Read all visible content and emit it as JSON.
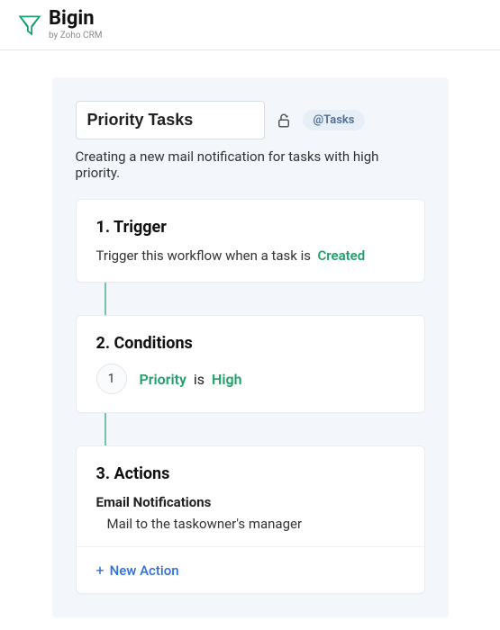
{
  "brand": {
    "name": "Bigin",
    "tagline": "by Zoho CRM"
  },
  "workflow": {
    "title": "Priority Tasks",
    "tag": "@Tasks",
    "description": "Creating a new mail notification for tasks with high priority."
  },
  "trigger": {
    "heading": "1. Trigger",
    "prefix": "Trigger this workflow when a task is",
    "event": "Created"
  },
  "conditions": {
    "heading": "2. Conditions",
    "items": [
      {
        "index": "1",
        "field": "Priority",
        "op": "is",
        "value": "High"
      }
    ]
  },
  "actions": {
    "heading": "3. Actions",
    "section_label": "Email Notifications",
    "items": [
      "Mail to the taskowner's manager"
    ],
    "new_action_label": "New Action"
  },
  "colors": {
    "accent": "#22a06b",
    "link": "#2f6fd8"
  }
}
